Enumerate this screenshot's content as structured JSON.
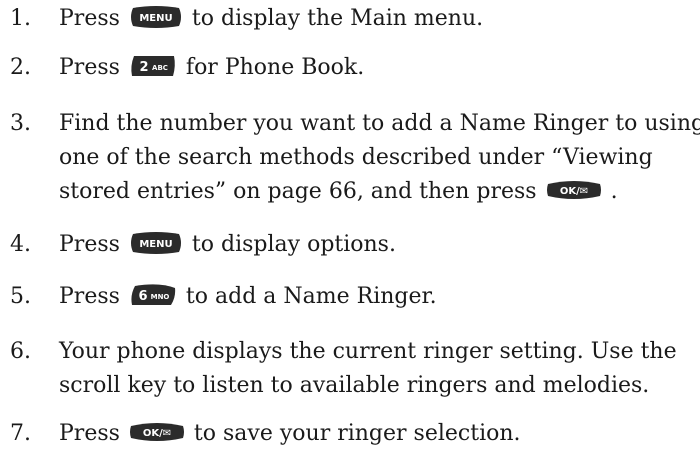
{
  "steps": [
    {
      "num": "1.",
      "before": "Press",
      "key": "MENU",
      "key_icon": "menu-key-icon",
      "after": "to display the Main menu."
    },
    {
      "num": "2.",
      "before": "Press",
      "key_main": "2",
      "key_sub": "ABC",
      "key_icon": "key-2abc-icon",
      "after": "for Phone Book."
    },
    {
      "num": "3.",
      "line1": "Find the number you want to add a Name Ringer to using",
      "line2": "one of the search methods described under “Viewing",
      "line3_before": "stored entries” on page 66, and then press",
      "key": "OK/✉",
      "key_icon": "ok-key-icon",
      "line3_after": "."
    },
    {
      "num": "4.",
      "before": "Press",
      "key": "MENU",
      "key_icon": "menu-key-icon",
      "after": "to display options."
    },
    {
      "num": "5.",
      "before": "Press",
      "key_main": "6",
      "key_sub": "MNO",
      "key_icon": "key-6mno-icon",
      "after": "to add a Name Ringer."
    },
    {
      "num": "6.",
      "line1": "Your phone displays the current ringer setting. Use the",
      "line2": "scroll key to listen to available ringers and melodies."
    },
    {
      "num": "7.",
      "before": "Press",
      "key": "OK/✉",
      "key_icon": "ok-key-icon",
      "after": "to save your ringer selection."
    }
  ],
  "colors": {
    "key_fill": "#2b2b2b",
    "key_text": "#ffffff",
    "body_text": "#1a1a1a"
  }
}
